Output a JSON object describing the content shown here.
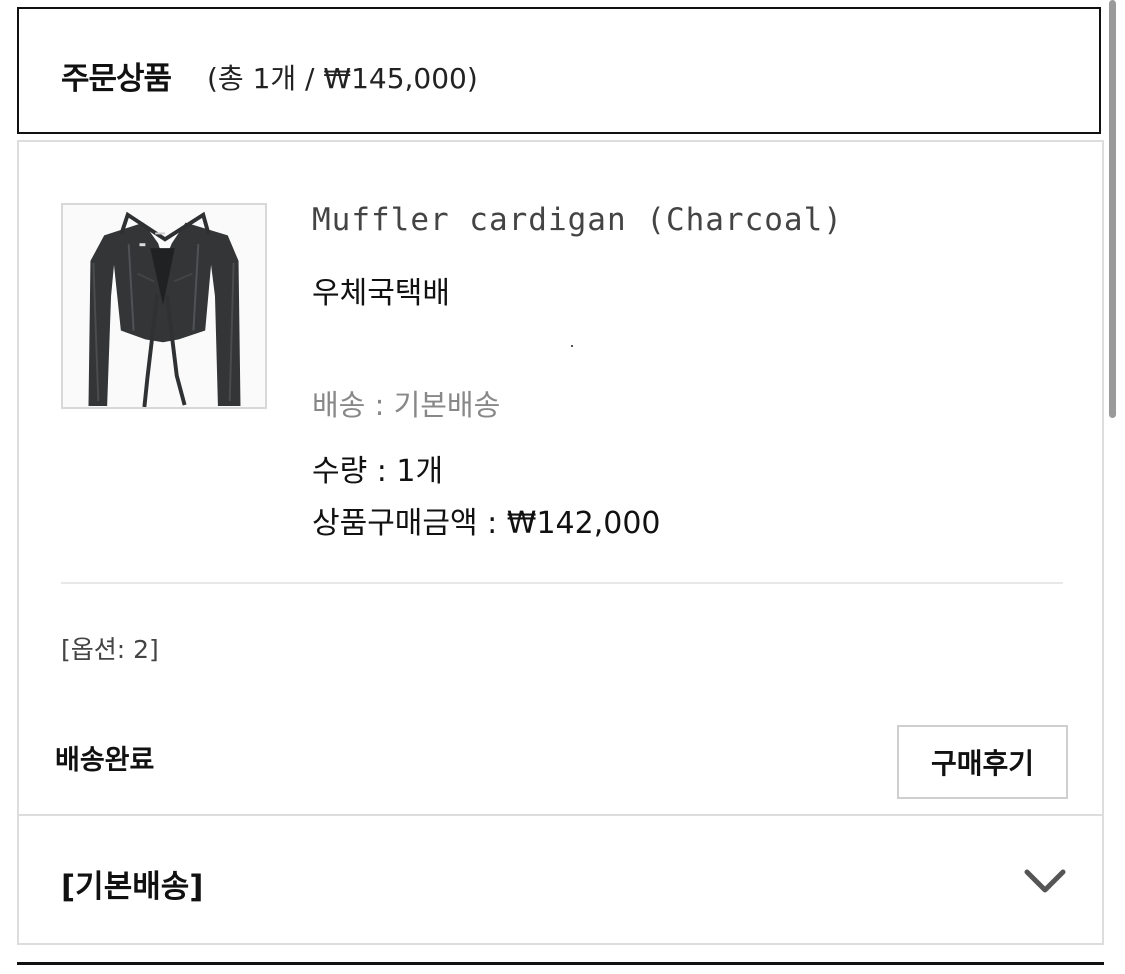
{
  "order_header": {
    "title": "주문상품",
    "summary": "(총 1개 / ₩145,000)"
  },
  "product": {
    "image_name": "charcoal-cardigan-image",
    "name": "Muffler cardigan (Charcoal)",
    "shipping_company": "우체국택배",
    "delivery": "배송 : 기본배송",
    "quantity": "수량 : 1개",
    "purchase_amount": "상품구매금액 : ₩142,000",
    "option": "[옵션: 2]",
    "status": "배송완료",
    "review_button": "구매후기"
  },
  "shipping_section": {
    "title": "[기본배송]",
    "toggle_icon": "chevron-down-icon"
  },
  "colors": {
    "border_dark": "#111111",
    "border_light": "#dddddd",
    "muted_text": "#888888"
  }
}
